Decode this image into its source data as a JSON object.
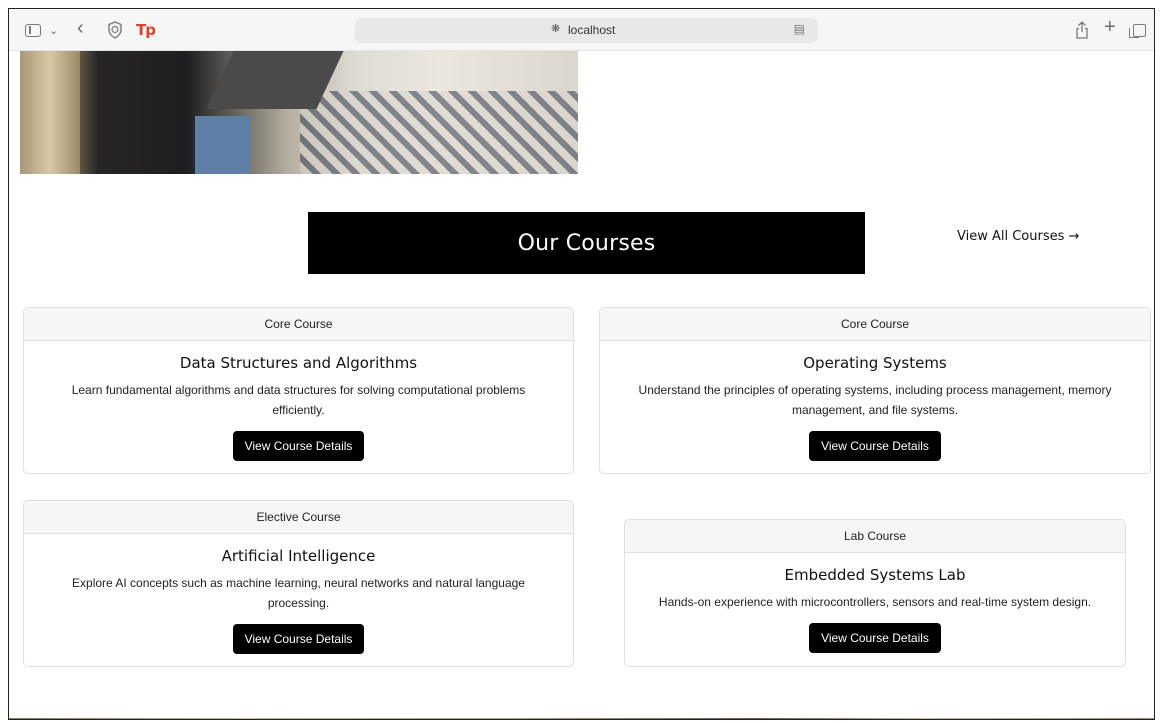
{
  "browser": {
    "url": "localhost"
  },
  "courses_section": {
    "title": "Our Courses",
    "view_all_label": "View All Courses →"
  },
  "courses": [
    {
      "category": "Core Course",
      "title": "Data Structures and Algorithms",
      "description": "Learn fundamental algorithms and data structures for solving computational problems efficiently.",
      "button_label": "View Course Details"
    },
    {
      "category": "Core Course",
      "title": "Operating Systems",
      "description": "Understand the principles of operating systems, including process management, memory management, and file systems.",
      "button_label": "View Course Details"
    },
    {
      "category": "Elective Course",
      "title": "Artificial Intelligence",
      "description": "Explore AI concepts such as machine learning, neural networks and natural language processing.",
      "button_label": "View Course Details"
    },
    {
      "category": "Lab Course",
      "title": "Embedded Systems Lab",
      "description": "Hands-on experience with microcontrollers, sensors and real-time system design.",
      "button_label": "View Course Details"
    }
  ]
}
